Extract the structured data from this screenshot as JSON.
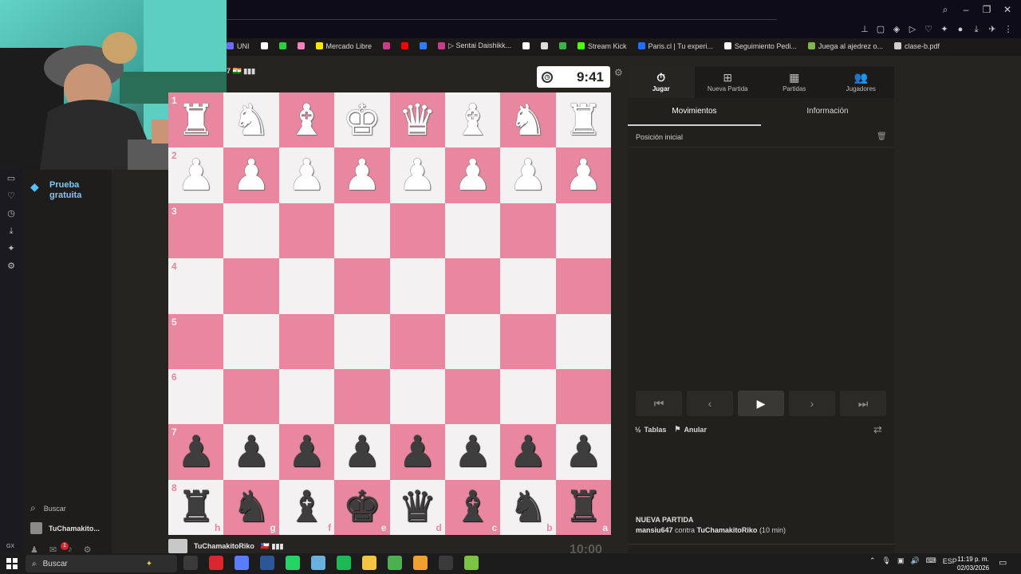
{
  "browser": {
    "bookmarks": [
      {
        "label": "UNI",
        "color": "#6b6bff"
      },
      {
        "label": "",
        "color": "#ffffff",
        "icon": "x-icon"
      },
      {
        "label": "",
        "color": "#2ecc40"
      },
      {
        "label": "",
        "color": "#ff7fbf"
      },
      {
        "label": "Mercado Libre",
        "color": "#ffe600"
      },
      {
        "label": "",
        "color": "#c83c8c"
      },
      {
        "label": "",
        "color": "#ff0000"
      },
      {
        "label": "",
        "color": "#2d7ff9"
      },
      {
        "label": "▷ Sentai Daishikk...",
        "color": "#c83c8c"
      },
      {
        "label": "",
        "color": "#ffffff"
      },
      {
        "label": "",
        "color": "#dcdcdc"
      },
      {
        "label": "",
        "color": "#3ab54a"
      },
      {
        "label": "Stream Kick",
        "color": "#53fc18"
      },
      {
        "label": "Paris.cl | Tu experi...",
        "color": "#1f6fff"
      },
      {
        "label": "Seguimiento Pedi...",
        "color": "#ffffff"
      },
      {
        "label": "Juega al ajedrez o...",
        "color": "#81b64c"
      },
      {
        "label": "clase-b.pdf",
        "color": "#cfcfcf"
      }
    ]
  },
  "nav": {
    "trial_label": "Prueba gratuita",
    "search_label": "Buscar",
    "username": "TuChamakito...",
    "notif_count": "1",
    "rail_label": "GX"
  },
  "game": {
    "opponent_partial": "7 🇮🇳 ▮▮▮",
    "opponent_clock": "9:41",
    "player_name": "TuChamakitoRiko",
    "player_flag": "🇨🇱 ▮▮▮",
    "player_clock": "10:00",
    "ranks": [
      "1",
      "2",
      "3",
      "4",
      "5",
      "6",
      "7",
      "8"
    ],
    "files": [
      "h",
      "g",
      "f",
      "e",
      "d",
      "c",
      "b",
      "a"
    ]
  },
  "panel": {
    "tabs": [
      {
        "label": "Jugar",
        "icon": "stopwatch-icon",
        "active": true
      },
      {
        "label": "Nueva Partida",
        "icon": "plus-square-icon",
        "active": false
      },
      {
        "label": "Partidas",
        "icon": "board-icon",
        "active": false
      },
      {
        "label": "Jugadores",
        "icon": "users-icon",
        "active": false
      }
    ],
    "subtabs": [
      {
        "label": "Movimientos",
        "active": true
      },
      {
        "label": "Información",
        "active": false
      }
    ],
    "start_position": "Posición inicial",
    "draw_label": "Tablas",
    "abort_label": "Anular",
    "game_header": "NUEVA PARTIDA",
    "game_white": "mansiu647",
    "game_vs": "contra",
    "game_black": "TuChamakitoRiko",
    "game_time": "(10 min)"
  },
  "taskbar": {
    "search_label": "Buscar",
    "lang": "ESP",
    "time": "11:19 p. m.",
    "date": "02/03/2026",
    "apps": [
      {
        "name": "task-view",
        "color": "#3a3a3a"
      },
      {
        "name": "opera-gx",
        "color": "#d8272e"
      },
      {
        "name": "copilot",
        "color": "#5a7dff"
      },
      {
        "name": "word",
        "color": "#2b579a"
      },
      {
        "name": "whatsapp",
        "color": "#25d366"
      },
      {
        "name": "app-blue",
        "color": "#6ab0de"
      },
      {
        "name": "spotify",
        "color": "#1db954"
      },
      {
        "name": "explorer",
        "color": "#f4c542"
      },
      {
        "name": "minecraft",
        "color": "#4caf50"
      },
      {
        "name": "store",
        "color": "#f0a030"
      },
      {
        "name": "obs",
        "color": "#3a3a3a"
      },
      {
        "name": "android",
        "color": "#7cc243"
      }
    ]
  }
}
